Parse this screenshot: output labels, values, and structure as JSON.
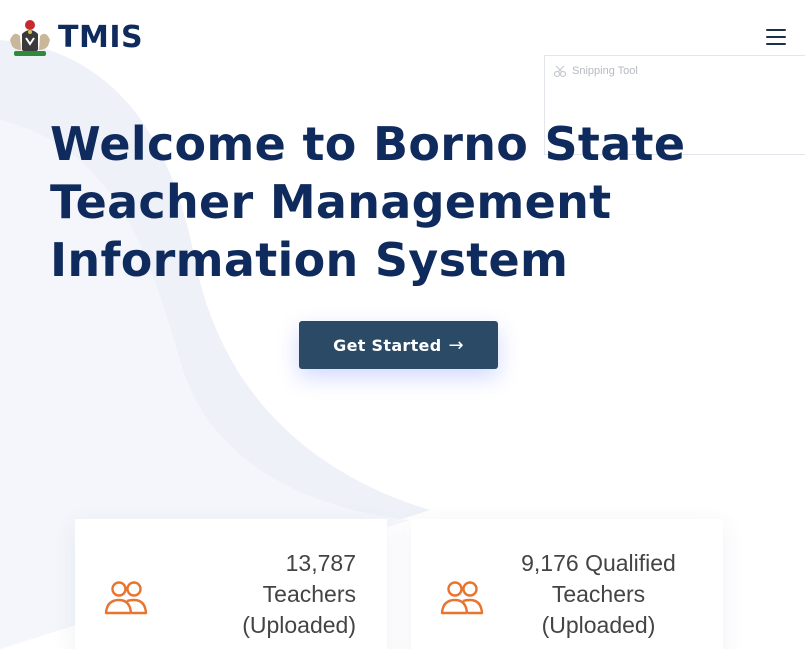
{
  "header": {
    "brand": "TMIS",
    "menu_icon": "hamburger-menu-icon",
    "logo_icon": "coat-of-arms-icon"
  },
  "overlay": {
    "title": "Snipping Tool",
    "icon": "scissors-icon"
  },
  "hero": {
    "title_line_1": "Welcome to Borno State",
    "title_line_2": "Teacher Management",
    "title_line_3": "Information System",
    "cta_label": "Get Started",
    "cta_arrow": "→"
  },
  "stats": [
    {
      "line_1": "13,787",
      "line_2": "Teachers",
      "line_3": "(Uploaded)",
      "icon": "users-icon"
    },
    {
      "line_1": "9,176 Qualified",
      "line_2": "Teachers",
      "line_3": "(Uploaded)",
      "icon": "users-icon"
    }
  ],
  "colors": {
    "title": "#0f2a5c",
    "button": "#2b4a66",
    "accent_icon": "#e8742e",
    "stat_text": "#444444"
  }
}
